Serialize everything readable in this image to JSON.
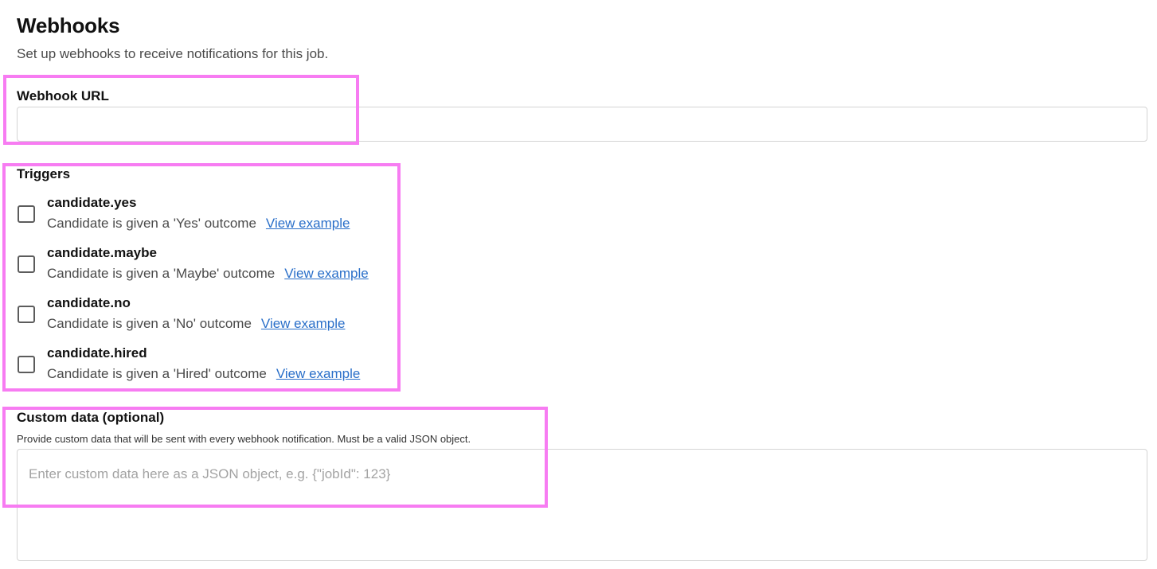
{
  "header": {
    "title": "Webhooks",
    "subtitle": "Set up webhooks to receive notifications for this job."
  },
  "webhook_url": {
    "label": "Webhook URL",
    "value": ""
  },
  "triggers": {
    "label": "Triggers",
    "items": [
      {
        "name": "candidate.yes",
        "description": "Candidate is given a 'Yes' outcome",
        "link_label": "View example",
        "checked": false
      },
      {
        "name": "candidate.maybe",
        "description": "Candidate is given a 'Maybe' outcome",
        "link_label": "View example",
        "checked": false
      },
      {
        "name": "candidate.no",
        "description": "Candidate is given a 'No' outcome",
        "link_label": "View example",
        "checked": false
      },
      {
        "name": "candidate.hired",
        "description": "Candidate is given a 'Hired' outcome",
        "link_label": "View example",
        "checked": false
      }
    ]
  },
  "custom_data": {
    "label": "Custom data (optional)",
    "help": "Provide custom data that will be sent with every webhook notification. Must be a valid JSON object.",
    "placeholder": "Enter custom data here as a JSON object, e.g. {\"jobId\": 123}",
    "value": ""
  },
  "colors": {
    "highlight": "#f77cf2",
    "link": "#2a6fc9",
    "border": "#d4d4d4",
    "muted_text": "#4a4a4a"
  }
}
